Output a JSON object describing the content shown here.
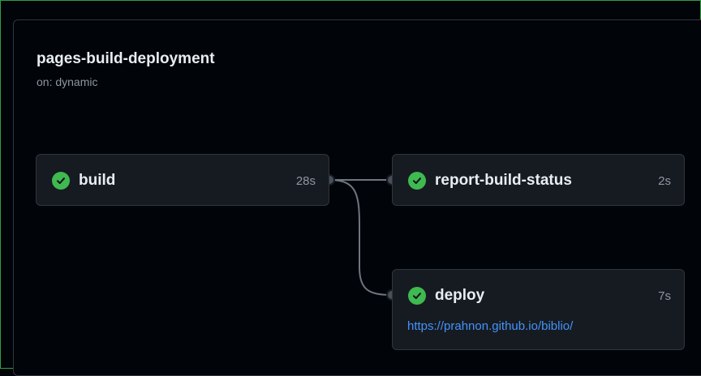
{
  "workflow": {
    "title": "pages-build-deployment",
    "trigger": "on: dynamic"
  },
  "jobs": {
    "build": {
      "name": "build",
      "duration": "28s",
      "status": "success"
    },
    "report": {
      "name": "report-build-status",
      "duration": "2s",
      "status": "success"
    },
    "deploy": {
      "name": "deploy",
      "duration": "7s",
      "status": "success",
      "url": "https://prahnon.github.io/biblio/"
    }
  },
  "colors": {
    "success": "#3fb950",
    "link": "#4493f8",
    "frame_border": "#2ea043"
  },
  "icons": {
    "status": "check-circle-icon"
  }
}
